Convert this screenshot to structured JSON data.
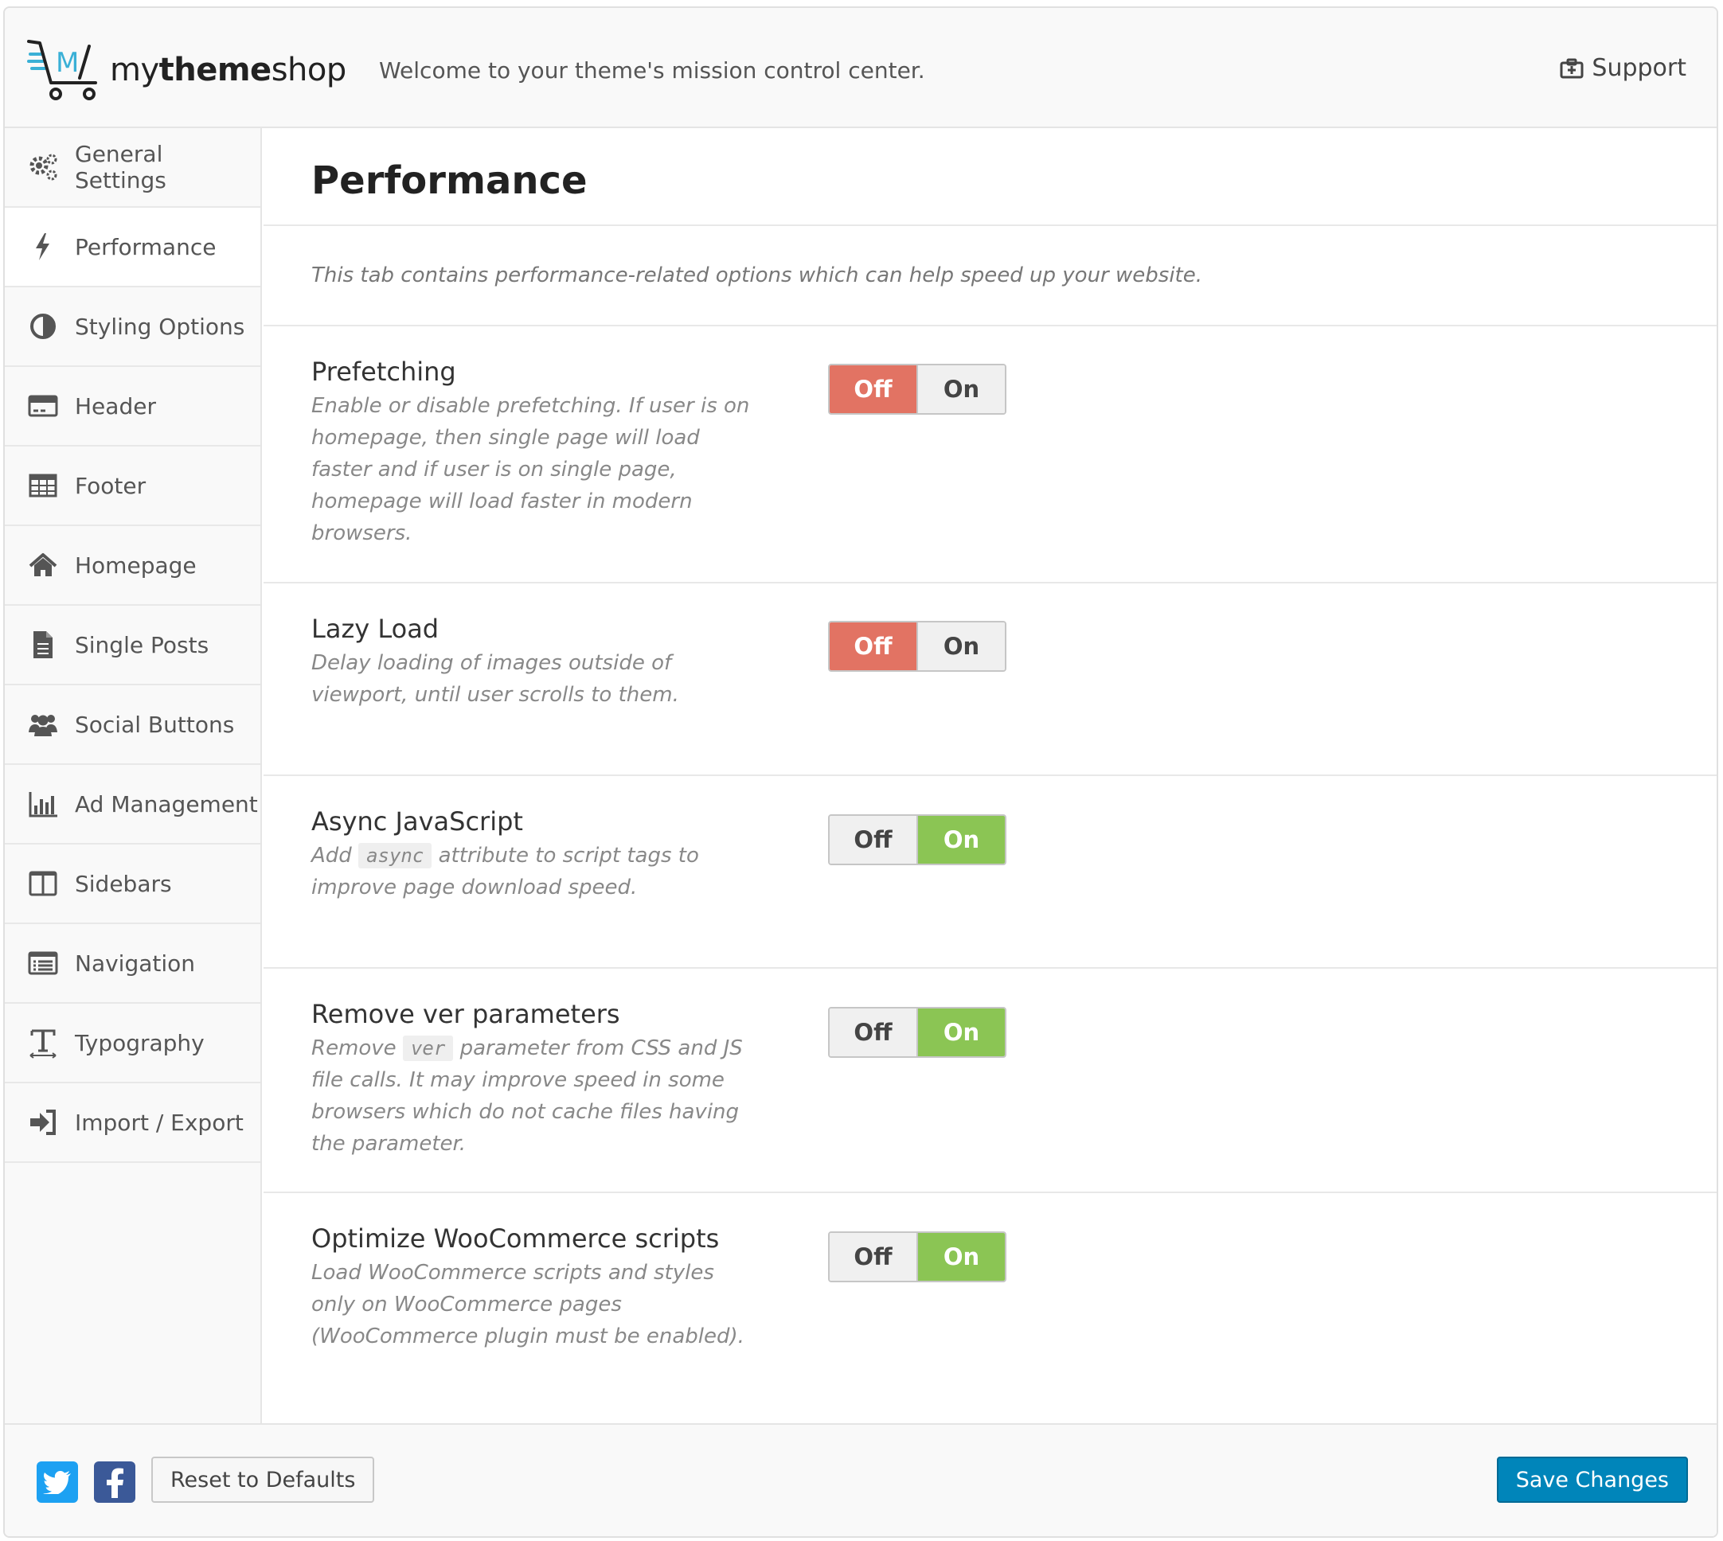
{
  "header": {
    "brand_prefix": "my",
    "brand_bold": "theme",
    "brand_suffix": "shop",
    "tagline": "Welcome to your theme's mission control center.",
    "support_label": "Support"
  },
  "sidebar": {
    "items": [
      {
        "label": "General Settings",
        "icon": "gears-icon"
      },
      {
        "label": "Performance",
        "icon": "bolt-icon",
        "active": true
      },
      {
        "label": "Styling Options",
        "icon": "contrast-icon"
      },
      {
        "label": "Header",
        "icon": "header-icon"
      },
      {
        "label": "Footer",
        "icon": "table-icon"
      },
      {
        "label": "Homepage",
        "icon": "home-icon"
      },
      {
        "label": "Single Posts",
        "icon": "document-icon"
      },
      {
        "label": "Social Buttons",
        "icon": "users-icon"
      },
      {
        "label": "Ad Management",
        "icon": "bar-chart-icon"
      },
      {
        "label": "Sidebars",
        "icon": "columns-icon"
      },
      {
        "label": "Navigation",
        "icon": "list-icon"
      },
      {
        "label": "Typography",
        "icon": "text-height-icon"
      },
      {
        "label": "Import / Export",
        "icon": "sign-in-icon"
      }
    ]
  },
  "main": {
    "title": "Performance",
    "intro": "This tab contains performance-related options which can help speed up your website.",
    "options": [
      {
        "title": "Prefetching",
        "desc": "Enable or disable prefetching. If user is on homepage, then single page will load faster and if user is on single page, homepage will load faster in modern browsers.",
        "value": "off"
      },
      {
        "title": "Lazy Load",
        "desc": "Delay loading of images outside of viewport, until user scrolls to them.",
        "value": "off"
      },
      {
        "title": "Async JavaScript",
        "desc_before": "Add",
        "desc_code": "async",
        "desc_after": "attribute to script tags to improve page download speed.",
        "value": "on"
      },
      {
        "title": "Remove ver parameters",
        "desc_before": "Remove",
        "desc_code": "ver",
        "desc_after": "parameter from CSS and JS file calls. It may improve speed in some browsers which do not cache files having the parameter.",
        "value": "on"
      },
      {
        "title": "Optimize WooCommerce scripts",
        "desc": "Load WooCommerce scripts and styles only on WooCommerce pages (WooCommerce plugin must be enabled).",
        "value": "on"
      }
    ],
    "switch_labels": {
      "off": "Off",
      "on": "On"
    }
  },
  "footer": {
    "reset_label": "Reset to Defaults",
    "save_label": "Save Changes"
  },
  "colors": {
    "off_active": "#e27363",
    "on_active": "#8bc554",
    "save_button": "#0085ba",
    "twitter": "#1da1f2",
    "facebook": "#3b5998"
  }
}
